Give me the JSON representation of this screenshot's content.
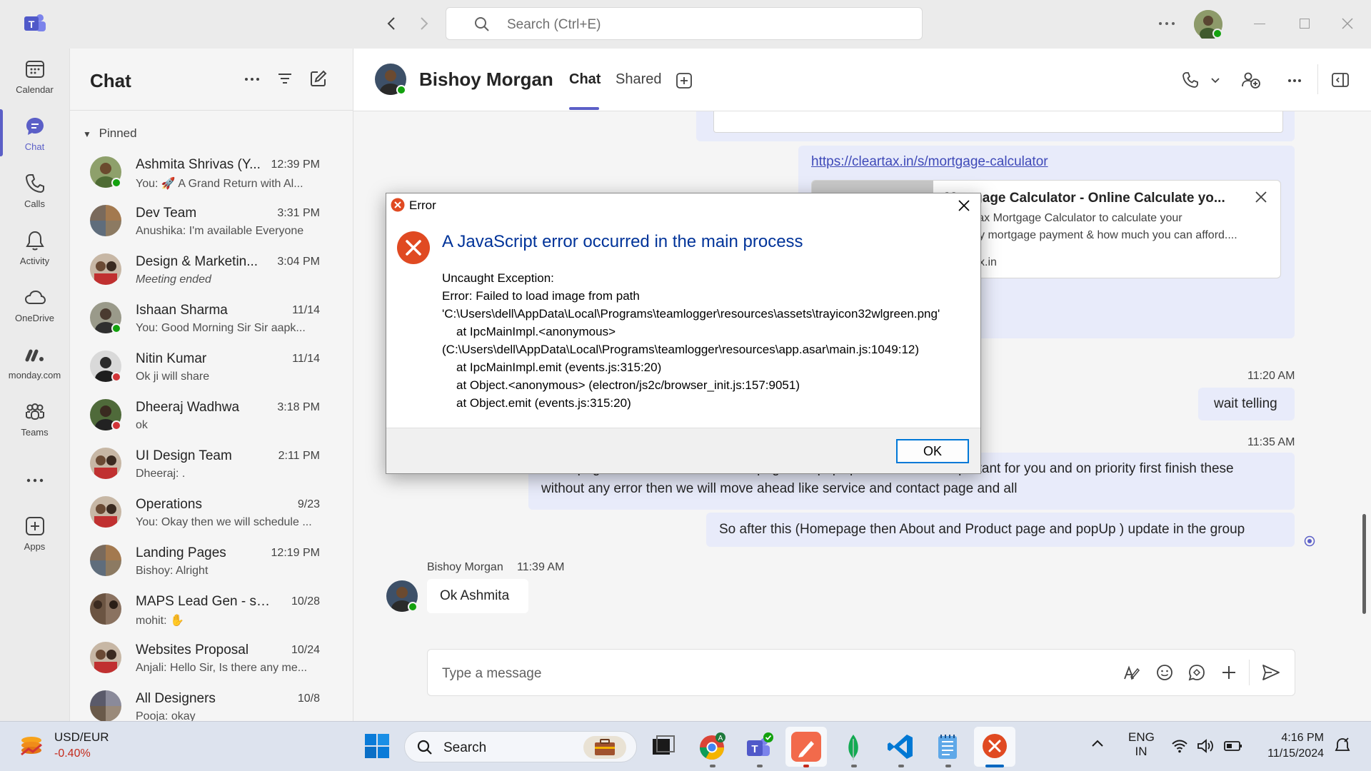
{
  "topbar": {
    "search_placeholder": "Search (Ctrl+E)"
  },
  "rail": {
    "items": [
      {
        "label": "Calendar",
        "icon": "calendar-icon"
      },
      {
        "label": "Chat",
        "icon": "chat-icon"
      },
      {
        "label": "Calls",
        "icon": "phone-icon"
      },
      {
        "label": "Activity",
        "icon": "bell-icon"
      },
      {
        "label": "OneDrive",
        "icon": "cloud-icon"
      },
      {
        "label": "monday.com",
        "icon": "monday-icon"
      },
      {
        "label": "Teams",
        "icon": "teams-icon"
      },
      {
        "label": "...",
        "icon": "more-icon"
      },
      {
        "label": "Apps",
        "icon": "add-apps-icon"
      }
    ]
  },
  "chatlist": {
    "title": "Chat",
    "pinned_label": "Pinned",
    "chats": [
      {
        "name": "Ashmita Shrivas (Y...",
        "time": "12:39 PM",
        "preview": "You: 🚀 A Grand Return with Al...",
        "presence": "available"
      },
      {
        "name": "Dev Team",
        "time": "3:31 PM",
        "preview": "Anushika: I'm available Everyone",
        "presence": ""
      },
      {
        "name": "Design & Marketin...",
        "time": "3:04 PM",
        "preview": "Meeting ended",
        "presence": "",
        "italic": true
      },
      {
        "name": "Ishaan Sharma",
        "time": "11/14",
        "preview": "You: Good Morning Sir  Sir aapk...",
        "presence": "available"
      },
      {
        "name": "Nitin Kumar",
        "time": "11/14",
        "preview": "Ok ji will share",
        "presence": "busy"
      },
      {
        "name": "Dheeraj Wadhwa",
        "time": "3:18 PM",
        "preview": "ok",
        "presence": "busy"
      },
      {
        "name": "UI Design Team",
        "time": "2:11 PM",
        "preview": "Dheeraj: .",
        "presence": ""
      },
      {
        "name": "Operations",
        "time": "9/23",
        "preview": "You: Okay then we will schedule ...",
        "presence": ""
      },
      {
        "name": "Landing Pages",
        "time": "12:19 PM",
        "preview": "Bishoy: Alright",
        "presence": ""
      },
      {
        "name": "MAPS Lead Gen - soc...",
        "time": "10/28",
        "preview": "mohit: ✋",
        "presence": ""
      },
      {
        "name": "Websites Proposal",
        "time": "10/24",
        "preview": "Anjali: Hello Sir, Is there any me...",
        "presence": ""
      },
      {
        "name": "All Designers",
        "time": "10/8",
        "preview": "Pooja: okay",
        "presence": ""
      }
    ]
  },
  "conversation": {
    "name": "Bishoy Morgan",
    "tabs": [
      "Chat",
      "Shared"
    ],
    "link_url": "https://cleartax.in/s/mortgage-calculator",
    "link_card_title": "Mortgage Calculator - Online Calculate yo...",
    "link_card_desc_1": "ClearTax Mortgage Calculator to calculate your",
    "link_card_desc_2": "monthly mortgage payment & how much you can afford....",
    "link_card_domain": "cleartax.in",
    "time_1": "11:20 AM",
    "msg_wait": "wait telling",
    "time_2": "11:35 AM",
    "msg_long_1": "Homepage then About and Product page and popUp these are the important for you and on priority first finish these",
    "msg_long_2": "without any error then we will move ahead like service and contact page and all",
    "msg_so": "So after this (Homepage then About and Product page and popUp ) update in the group",
    "reply_sender": "Bishoy Morgan",
    "reply_time": "11:39 AM",
    "reply_text": "Ok Ashmita",
    "compose_placeholder": "Type a message"
  },
  "dialog": {
    "title": "Error",
    "heading": "A JavaScript error occurred in the main process",
    "lines": [
      "Uncaught Exception:",
      "Error: Failed to load image from path",
      "'C:\\Users\\dell\\AppData\\Local\\Programs\\teamlogger\\resources\\assets\\trayicon32wlgreen.png'",
      "    at IpcMainImpl.<anonymous>",
      "(C:\\Users\\dell\\AppData\\Local\\Programs\\teamlogger\\resources\\app.asar\\main.js:1049:12)",
      "    at IpcMainImpl.emit (events.js:315:20)",
      "    at Object.<anonymous> (electron/js2c/browser_init.js:157:9051)",
      "    at Object.emit (events.js:315:20)"
    ],
    "ok_label": "OK"
  },
  "taskbar": {
    "widget_title": "USD/EUR",
    "widget_value": "-0.40%",
    "search_label": "Search",
    "lang_1": "ENG",
    "lang_2": "IN",
    "clock_time": "4:16 PM",
    "clock_date": "11/15/2024"
  },
  "colors": {
    "accent": "#5b5fc7",
    "available": "#13a10e",
    "busy": "#d13438",
    "error": "#e81123"
  }
}
